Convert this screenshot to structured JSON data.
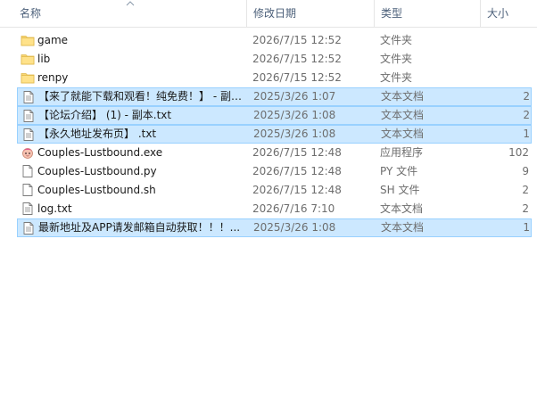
{
  "columns": {
    "name": "名称",
    "date": "修改日期",
    "type": "类型",
    "size": "大小"
  },
  "files": [
    {
      "name": "game",
      "date": "2026/7/15 12:52",
      "type": "文件夹",
      "size": "",
      "icon": "folder-icon",
      "selected": false
    },
    {
      "name": "lib",
      "date": "2026/7/15 12:52",
      "type": "文件夹",
      "size": "",
      "icon": "folder-icon",
      "selected": false
    },
    {
      "name": "renpy",
      "date": "2026/7/15 12:52",
      "type": "文件夹",
      "size": "",
      "icon": "folder-icon",
      "selected": false
    },
    {
      "name": "【来了就能下载和观看！纯免费！】 - 副…",
      "date": "2025/3/26 1:07",
      "type": "文本文档",
      "size": "2",
      "icon": "text-file-icon",
      "selected": true
    },
    {
      "name": "【论坛介绍】 (1) - 副本.txt",
      "date": "2025/3/26 1:08",
      "type": "文本文档",
      "size": "2",
      "icon": "text-file-icon",
      "selected": true
    },
    {
      "name": "【永久地址发布页】 .txt",
      "date": "2025/3/26 1:08",
      "type": "文本文档",
      "size": "1",
      "icon": "text-file-icon",
      "selected": true
    },
    {
      "name": "Couples-Lustbound.exe",
      "date": "2026/7/15 12:48",
      "type": "应用程序",
      "size": "102",
      "icon": "app-icon",
      "selected": false
    },
    {
      "name": "Couples-Lustbound.py",
      "date": "2026/7/15 12:48",
      "type": "PY 文件",
      "size": "9",
      "icon": "blank-file-icon",
      "selected": false
    },
    {
      "name": "Couples-Lustbound.sh",
      "date": "2026/7/15 12:48",
      "type": "SH 文件",
      "size": "2",
      "icon": "blank-file-icon",
      "selected": false
    },
    {
      "name": "log.txt",
      "date": "2026/7/16 7:10",
      "type": "文本文档",
      "size": "2",
      "icon": "text-file-icon",
      "selected": false
    },
    {
      "name": "最新地址及APP请发邮箱自动获取！！！...",
      "date": "2025/3/26 1:08",
      "type": "文本文档",
      "size": "1",
      "icon": "text-file-icon",
      "selected": true
    }
  ]
}
